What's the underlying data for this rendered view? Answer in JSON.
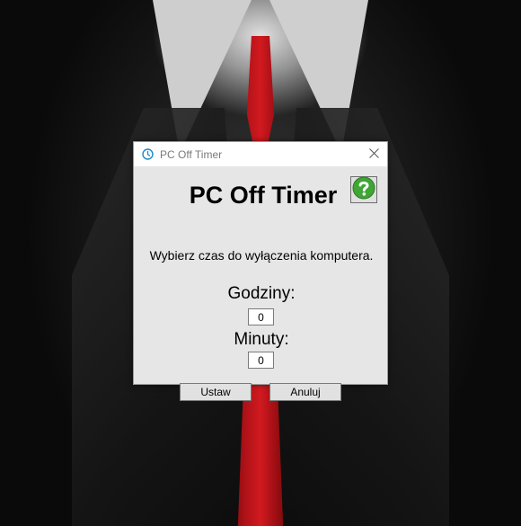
{
  "window": {
    "title": "PC Off Timer",
    "close_icon": "close-icon",
    "clock_icon": "clock-icon"
  },
  "main": {
    "heading": "PC Off Timer",
    "help_icon": "help-icon",
    "description": "Wybierz czas do wyłączenia komputera.",
    "hours_label": "Godziny:",
    "hours_value": "0",
    "minutes_label": "Minuty:",
    "minutes_value": "0",
    "set_label": "Ustaw",
    "cancel_label": "Anuluj"
  },
  "colors": {
    "help_green": "#3fa535",
    "clock_blue": "#1e88c8"
  }
}
